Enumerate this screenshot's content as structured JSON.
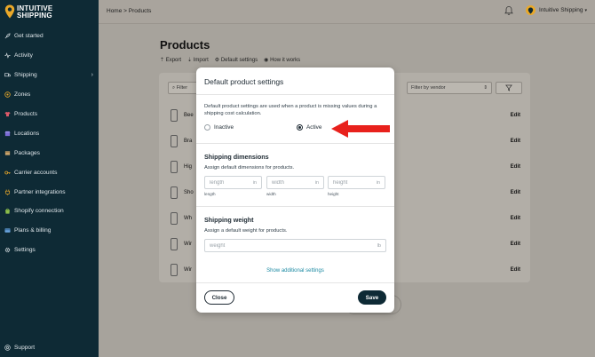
{
  "app": {
    "logo_line1": "INTUITIVE",
    "logo_line2": "SHIPPING"
  },
  "sidebar": {
    "items": [
      {
        "label": "Get started",
        "icon": "rocket-icon"
      },
      {
        "label": "Activity",
        "icon": "pulse-icon"
      },
      {
        "label": "Shipping",
        "icon": "truck-icon",
        "has_submenu": true
      },
      {
        "label": "Zones",
        "icon": "target-icon"
      },
      {
        "label": "Products",
        "icon": "shirt-icon",
        "active": true
      },
      {
        "label": "Locations",
        "icon": "store-icon"
      },
      {
        "label": "Packages",
        "icon": "box-icon"
      },
      {
        "label": "Carrier accounts",
        "icon": "key-icon"
      },
      {
        "label": "Partner integrations",
        "icon": "plug-icon"
      },
      {
        "label": "Shopify connection",
        "icon": "bag-icon"
      },
      {
        "label": "Plans & billing",
        "icon": "card-icon"
      },
      {
        "label": "Settings",
        "icon": "gear-icon"
      }
    ],
    "support_label": "Support"
  },
  "topbar": {
    "breadcrumb": "Home > Products",
    "account_name": "Intuitive Shipping"
  },
  "page": {
    "title": "Products",
    "actions": [
      "Export",
      "Import",
      "Default settings",
      "How it works"
    ],
    "filter_left_placeholder": "Filter",
    "filter_vendor_placeholder": "Filter by vendor",
    "rows": [
      {
        "name": "Bee",
        "edit": "Edit"
      },
      {
        "name": "Bra",
        "edit": "Edit"
      },
      {
        "name": "Hig",
        "edit": "Edit"
      },
      {
        "name": "Sho",
        "edit": "Edit"
      },
      {
        "name": "Wh",
        "edit": "Edit"
      },
      {
        "name": "Wir",
        "edit": "Edit"
      },
      {
        "name": "Wir",
        "edit": "Edit"
      }
    ]
  },
  "modal": {
    "title": "Default product settings",
    "description": "Default product settings are used when a product is missing values during a shipping cost calculation.",
    "radio_inactive": "Inactive",
    "radio_active": "Active",
    "selected": "Active",
    "dimensions_title": "Shipping dimensions",
    "dimensions_sub": "Assign default dimensions for products.",
    "length_placeholder": "length",
    "width_placeholder": "width",
    "height_placeholder": "height",
    "dim_unit": "in",
    "length_caption": "length",
    "width_caption": "width",
    "height_caption": "height",
    "weight_title": "Shipping weight",
    "weight_sub": "Assign a default weight for products.",
    "weight_placeholder": "weight",
    "weight_unit": "lb",
    "additional_link": "Show additional settings",
    "close_label": "Close",
    "save_label": "Save"
  },
  "colors": {
    "sidebar_bg": "#0e2a35",
    "accent": "#1c8aa3",
    "annotation_arrow": "#e8211c",
    "logo_gold": "#e9a829"
  }
}
